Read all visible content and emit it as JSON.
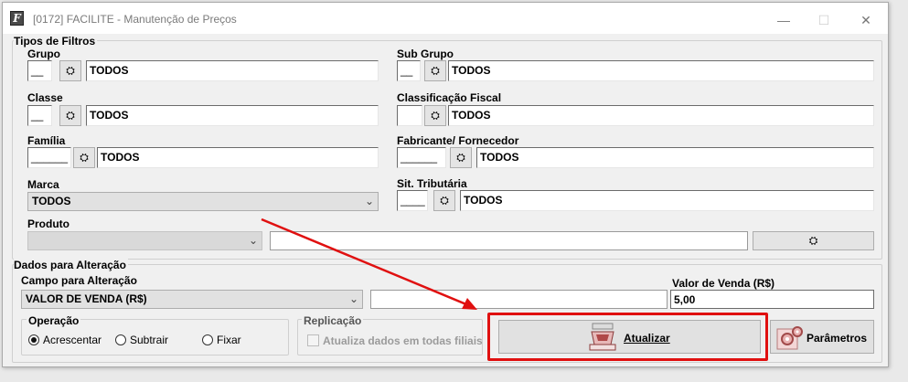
{
  "window": {
    "title": "[0172] FACILITE - Manutenção de Preços",
    "app_icon": "F",
    "minimize": "—",
    "maximize": "☐",
    "close": "✕"
  },
  "filters": {
    "group_title": "Tipos de Filtros",
    "grupo": {
      "label": "Grupo",
      "code": "__",
      "value": "TODOS"
    },
    "subgrupo": {
      "label": "Sub Grupo",
      "code": "__",
      "value": "TODOS"
    },
    "classe": {
      "label": "Classe",
      "code": "__",
      "value": "TODOS"
    },
    "classificacao_fiscal": {
      "label": "Classificação Fiscal",
      "code": "",
      "value": "TODOS"
    },
    "familia": {
      "label": "Família",
      "code": "______",
      "value": "TODOS"
    },
    "fabricante": {
      "label": "Fabricante/ Fornecedor",
      "code": "______",
      "value": "TODOS"
    },
    "marca": {
      "label": "Marca",
      "value": "TODOS"
    },
    "sit_tributaria": {
      "label": "Sit. Tributária",
      "code": "____",
      "value": "TODOS"
    },
    "produto": {
      "label": "Produto",
      "value": "",
      "text": ""
    }
  },
  "alteracao": {
    "group_title": "Dados para Alteração",
    "campo_label": "Campo para Alteração",
    "campo_value": "VALOR DE VENDA (R$)",
    "middle_value": "",
    "valor_label": "Valor de Venda (R$)",
    "valor_value": "5,00"
  },
  "operacao": {
    "title": "Operação",
    "options": [
      "Acrescentar",
      "Subtrair",
      "Fixar"
    ],
    "selected": "Acrescentar"
  },
  "replicacao": {
    "title": "Replicação",
    "checkbox_label": "Atualiza dados em todas filiais",
    "checked": false
  },
  "buttons": {
    "atualizar": "Atualizar",
    "parametros": "Parâmetros"
  },
  "annotation": {
    "arrow_color": "#e01010",
    "highlight_color": "#e01010"
  }
}
